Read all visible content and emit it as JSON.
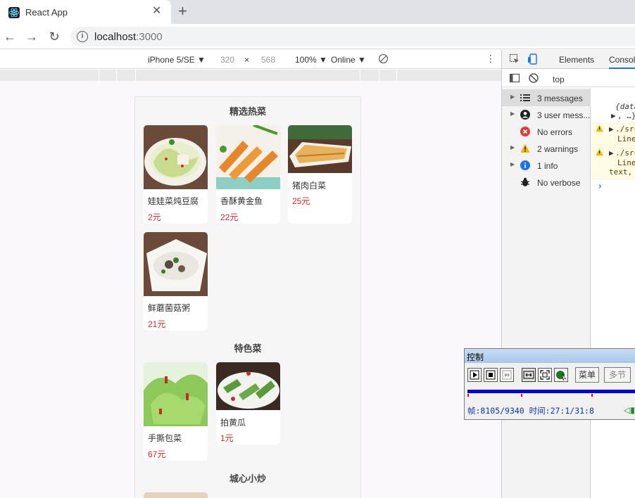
{
  "browser": {
    "tab_title": "React App",
    "url_host": "localhost",
    "url_port": ":3000"
  },
  "device_toolbar": {
    "device": "iPhone 5/SE ▼",
    "width": "320",
    "times": "×",
    "height": "568",
    "zoom": "100% ▼",
    "network": "Online ▼"
  },
  "menu": {
    "categories": [
      {
        "title": "精选热菜",
        "dishes": [
          {
            "name": "娃娃菜炖豆腐",
            "price": "2元"
          },
          {
            "name": "香酥黄金鱼",
            "price": "22元"
          },
          {
            "name": "猪肉白菜",
            "price": "25元"
          },
          {
            "name": "鲜蘑菌菇粥",
            "price": "21元"
          }
        ]
      },
      {
        "title": "特色菜",
        "dishes": [
          {
            "name": "手撕包菜",
            "price": "67元"
          },
          {
            "name": "拍黄瓜",
            "price": "1元"
          }
        ]
      },
      {
        "title": "城心小炒",
        "dishes": []
      }
    ]
  },
  "devtools": {
    "tabs": {
      "elements": "Elements",
      "console": "Console"
    },
    "context": "top",
    "sidebar": [
      {
        "label": "3 messages",
        "icon": "list-icon"
      },
      {
        "label": "3 user mess...",
        "icon": "user-icon"
      },
      {
        "label": "No errors",
        "icon": "error-icon"
      },
      {
        "label": "2 warnings",
        "icon": "warning-icon"
      },
      {
        "label": "1 info",
        "icon": "info-icon"
      },
      {
        "label": "No verbose",
        "icon": "bug-icon"
      }
    ],
    "log": {
      "line1": "{data",
      "line1b": ", …}",
      "warn1_a": "./src",
      "warn1_b": "Line",
      "warn2_a": "./src",
      "warn2_b": "Line",
      "warn2_c": "text,",
      "prompt": "›"
    }
  },
  "control": {
    "title": "控制",
    "menu_btn": "菜单",
    "multi_btn": "多节",
    "status": "帧:8105/9340 时间:27:1/31:8"
  }
}
